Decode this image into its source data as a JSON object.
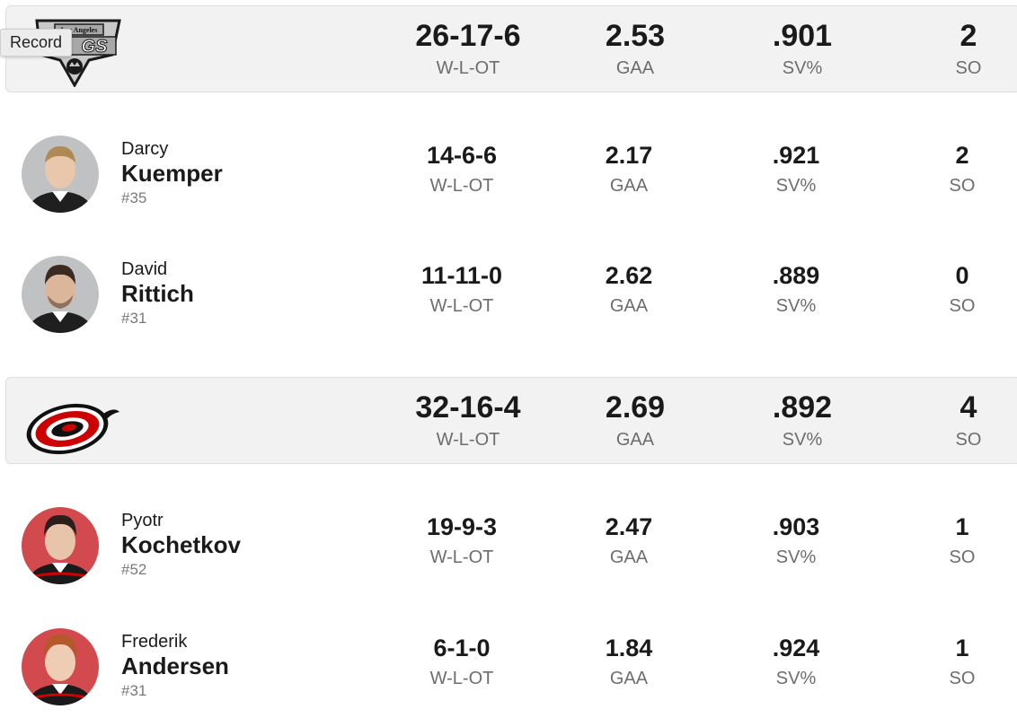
{
  "tooltip": "Record",
  "teams": [
    {
      "logo_icon": "los-angeles-kings-logo",
      "logo_text_top": "Los Angeles",
      "logo_text_main": "GS",
      "record": "26-17-6",
      "gaa": "2.53",
      "sv": ".901",
      "so": "2",
      "goalies": [
        {
          "first": "Darcy",
          "last": "Kuemper",
          "number": "#35",
          "record": "14-6-6",
          "gaa": "2.17",
          "sv": ".921",
          "so": "2"
        },
        {
          "first": "David",
          "last": "Rittich",
          "number": "#31",
          "record": "11-11-0",
          "gaa": "2.62",
          "sv": ".889",
          "so": "0"
        }
      ]
    },
    {
      "logo_icon": "carolina-hurricanes-logo",
      "record": "32-16-4",
      "gaa": "2.69",
      "sv": ".892",
      "so": "4",
      "goalies": [
        {
          "first": "Pyotr",
          "last": "Kochetkov",
          "number": "#52",
          "record": "19-9-3",
          "gaa": "2.47",
          "sv": ".903",
          "so": "1"
        },
        {
          "first": "Frederik",
          "last": "Andersen",
          "number": "#31",
          "record": "6-1-0",
          "gaa": "1.84",
          "sv": ".924",
          "so": "1"
        }
      ]
    }
  ],
  "labels": {
    "record": "W-L-OT",
    "gaa": "GAA",
    "sv": "SV%",
    "so": "SO"
  },
  "colors": {
    "header_bg": "#f2f2f2",
    "avatar_kings": "#bfc1c3",
    "avatar_canes": "#d24a4d",
    "canes_red": "#cc0000"
  }
}
